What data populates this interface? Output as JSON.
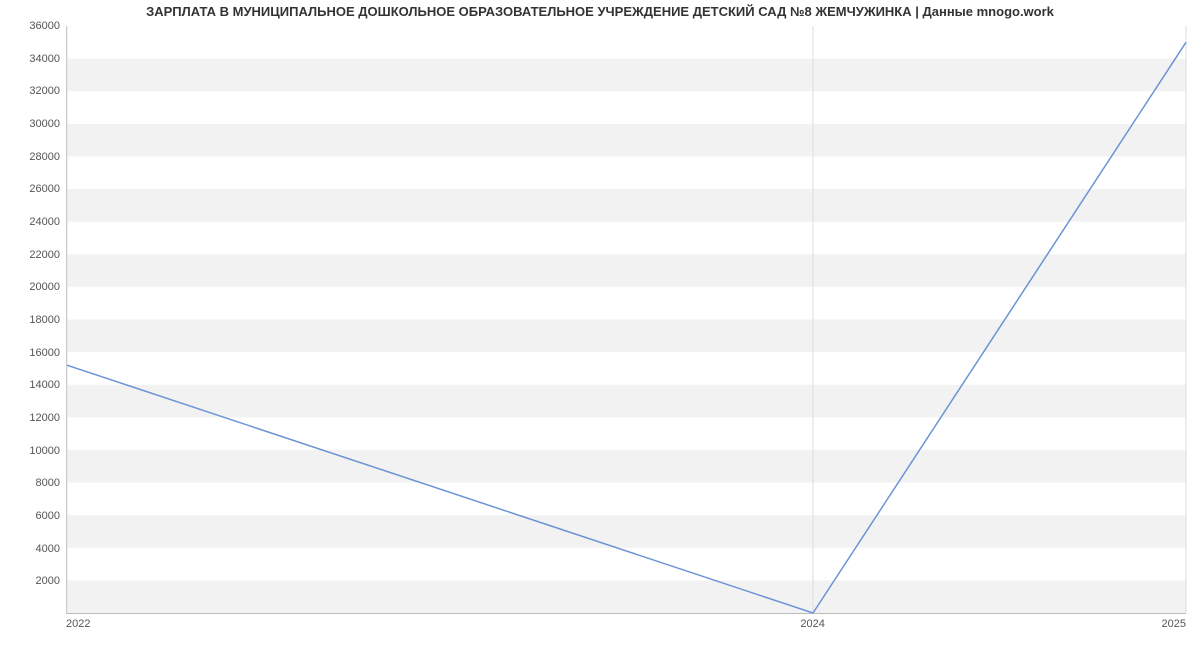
{
  "chart_data": {
    "type": "line",
    "title": "ЗАРПЛАТА В МУНИЦИПАЛЬНОЕ ДОШКОЛЬНОЕ ОБРАЗОВАТЕЛЬНОЕ УЧРЕЖДЕНИЕ ДЕТСКИЙ САД №8 ЖЕМЧУЖИНКА | Данные mnogo.work",
    "xlabel": "",
    "ylabel": "",
    "x": [
      2022,
      2024,
      2025
    ],
    "values": [
      15200,
      0,
      35000
    ],
    "xlim": [
      2022,
      2025
    ],
    "ylim": [
      0,
      36000
    ],
    "x_ticks": [
      2022,
      2024,
      2025
    ],
    "y_ticks": [
      2000,
      4000,
      6000,
      8000,
      10000,
      12000,
      14000,
      16000,
      18000,
      20000,
      22000,
      24000,
      26000,
      28000,
      30000,
      32000,
      34000,
      36000
    ],
    "grid": true,
    "series_name": ""
  }
}
